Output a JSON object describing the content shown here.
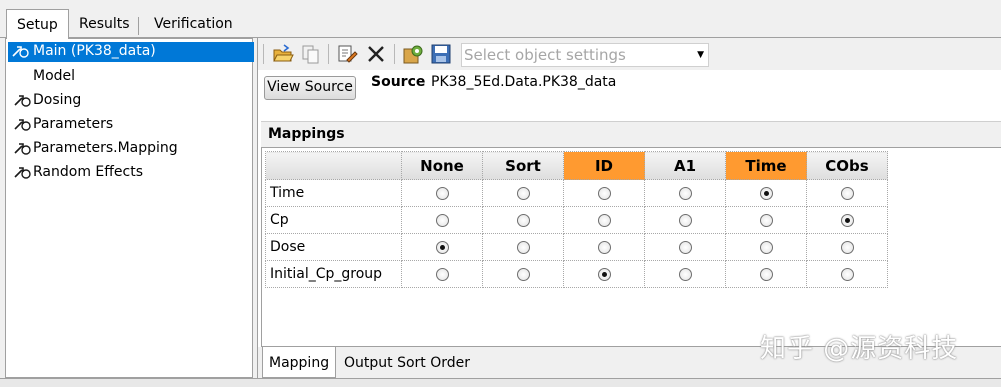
{
  "top_tabs": [
    "Setup",
    "Results",
    "Verification"
  ],
  "tree": {
    "items": [
      {
        "label": "Main (PK38_data)",
        "icon": "link-node-icon",
        "selected": true
      },
      {
        "label": "Model",
        "icon": "none",
        "selected": false
      },
      {
        "label": "Dosing",
        "icon": "link-node-icon",
        "selected": false
      },
      {
        "label": "Parameters",
        "icon": "link-node-icon",
        "selected": false
      },
      {
        "label": "Parameters.Mapping",
        "icon": "link-node-icon",
        "selected": false
      },
      {
        "label": "Random Effects",
        "icon": "link-node-icon",
        "selected": false
      }
    ]
  },
  "toolbar": {
    "settings_placeholder": "Select object settings",
    "icons": [
      "open-folder-icon",
      "copy-icon",
      "edit-icon",
      "delete-icon",
      "gear-object-icon",
      "save-icon"
    ]
  },
  "source": {
    "button_label": "View Source",
    "label": "Source",
    "value": "PK38_5Ed.Data.PK38_data"
  },
  "mappings": {
    "title": "Mappings",
    "columns": [
      "None",
      "Sort",
      "ID",
      "A1",
      "Time",
      "CObs"
    ],
    "highlight_color": "#ff9a30",
    "highlighted_columns": [
      "ID",
      "Time"
    ],
    "rows": [
      {
        "label": "Time",
        "selected": "Time"
      },
      {
        "label": "Cp",
        "selected": "CObs"
      },
      {
        "label": "Dose",
        "selected": "None"
      },
      {
        "label": "Initial_Cp_group",
        "selected": "ID"
      }
    ]
  },
  "bottom_tabs": [
    "Mapping",
    "Output Sort Order"
  ],
  "watermark": "知乎 @源资科技"
}
